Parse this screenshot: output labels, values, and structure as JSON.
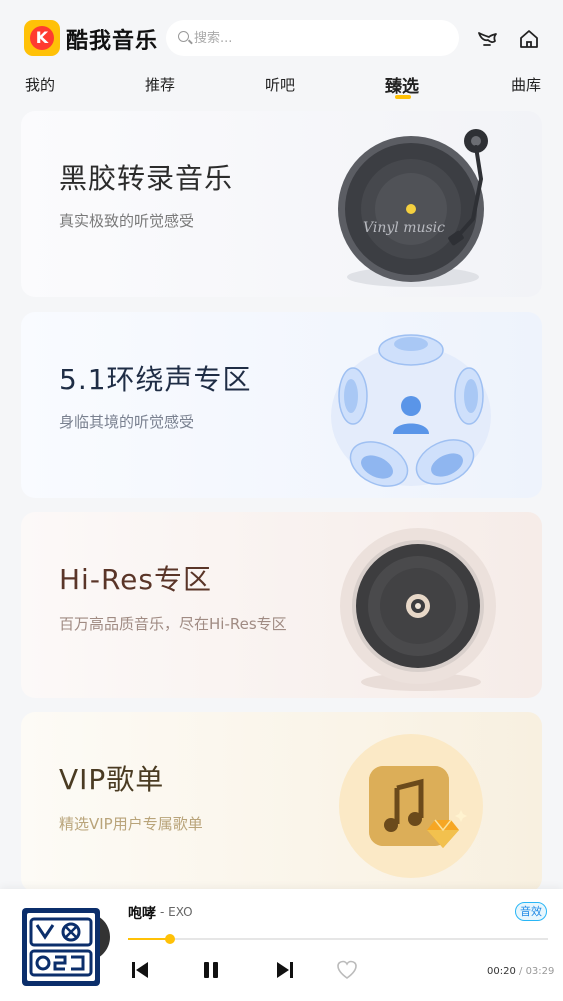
{
  "app": {
    "title": "酷我音乐",
    "logo_letter": "K"
  },
  "search": {
    "placeholder": "搜索..."
  },
  "header_icons": [
    "vip-bird-icon",
    "home-icon"
  ],
  "tabs": [
    {
      "label": "我的",
      "active": false
    },
    {
      "label": "推荐",
      "active": false
    },
    {
      "label": "听吧",
      "active": false
    },
    {
      "label": "臻选",
      "active": true
    },
    {
      "label": "曲库",
      "active": false
    }
  ],
  "cards": [
    {
      "title": "黑胶转录音乐",
      "subtitle": "真实极致的听觉感受",
      "art_text": "Vinyl music"
    },
    {
      "title": "5.1环绕声专区",
      "subtitle": "身临其境的听觉感受"
    },
    {
      "title": "Hi-Res专区",
      "subtitle": "百万高品质音乐，尽在Hi-Res专区"
    },
    {
      "title": "VIP歌单",
      "subtitle": "精选VIP用户专属歌单"
    }
  ],
  "player": {
    "song": "咆哮",
    "artist": "- EXO",
    "effect_label": "音效",
    "current_time": "00:20",
    "separator": " / ",
    "duration": "03:29",
    "progress": 0.1,
    "liked": false,
    "state": "playing"
  },
  "colors": {
    "accent": "#ffc107",
    "brand_red": "#ff3b30",
    "effect_blue": "#29b6f6"
  }
}
